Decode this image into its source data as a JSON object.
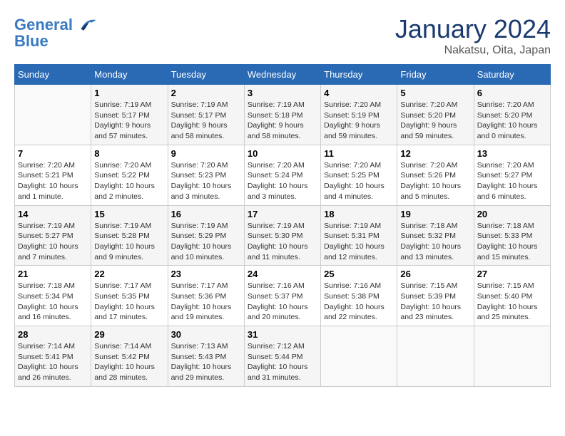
{
  "header": {
    "logo_line1": "General",
    "logo_line2": "Blue",
    "month_title": "January 2024",
    "subtitle": "Nakatsu, Oita, Japan"
  },
  "weekdays": [
    "Sunday",
    "Monday",
    "Tuesday",
    "Wednesday",
    "Thursday",
    "Friday",
    "Saturday"
  ],
  "weeks": [
    [
      {
        "day": "",
        "info": ""
      },
      {
        "day": "1",
        "info": "Sunrise: 7:19 AM\nSunset: 5:17 PM\nDaylight: 9 hours\nand 57 minutes."
      },
      {
        "day": "2",
        "info": "Sunrise: 7:19 AM\nSunset: 5:17 PM\nDaylight: 9 hours\nand 58 minutes."
      },
      {
        "day": "3",
        "info": "Sunrise: 7:19 AM\nSunset: 5:18 PM\nDaylight: 9 hours\nand 58 minutes."
      },
      {
        "day": "4",
        "info": "Sunrise: 7:20 AM\nSunset: 5:19 PM\nDaylight: 9 hours\nand 59 minutes."
      },
      {
        "day": "5",
        "info": "Sunrise: 7:20 AM\nSunset: 5:20 PM\nDaylight: 9 hours\nand 59 minutes."
      },
      {
        "day": "6",
        "info": "Sunrise: 7:20 AM\nSunset: 5:20 PM\nDaylight: 10 hours\nand 0 minutes."
      }
    ],
    [
      {
        "day": "7",
        "info": "Sunrise: 7:20 AM\nSunset: 5:21 PM\nDaylight: 10 hours\nand 1 minute."
      },
      {
        "day": "8",
        "info": "Sunrise: 7:20 AM\nSunset: 5:22 PM\nDaylight: 10 hours\nand 2 minutes."
      },
      {
        "day": "9",
        "info": "Sunrise: 7:20 AM\nSunset: 5:23 PM\nDaylight: 10 hours\nand 3 minutes."
      },
      {
        "day": "10",
        "info": "Sunrise: 7:20 AM\nSunset: 5:24 PM\nDaylight: 10 hours\nand 3 minutes."
      },
      {
        "day": "11",
        "info": "Sunrise: 7:20 AM\nSunset: 5:25 PM\nDaylight: 10 hours\nand 4 minutes."
      },
      {
        "day": "12",
        "info": "Sunrise: 7:20 AM\nSunset: 5:26 PM\nDaylight: 10 hours\nand 5 minutes."
      },
      {
        "day": "13",
        "info": "Sunrise: 7:20 AM\nSunset: 5:27 PM\nDaylight: 10 hours\nand 6 minutes."
      }
    ],
    [
      {
        "day": "14",
        "info": "Sunrise: 7:19 AM\nSunset: 5:27 PM\nDaylight: 10 hours\nand 7 minutes."
      },
      {
        "day": "15",
        "info": "Sunrise: 7:19 AM\nSunset: 5:28 PM\nDaylight: 10 hours\nand 9 minutes."
      },
      {
        "day": "16",
        "info": "Sunrise: 7:19 AM\nSunset: 5:29 PM\nDaylight: 10 hours\nand 10 minutes."
      },
      {
        "day": "17",
        "info": "Sunrise: 7:19 AM\nSunset: 5:30 PM\nDaylight: 10 hours\nand 11 minutes."
      },
      {
        "day": "18",
        "info": "Sunrise: 7:19 AM\nSunset: 5:31 PM\nDaylight: 10 hours\nand 12 minutes."
      },
      {
        "day": "19",
        "info": "Sunrise: 7:18 AM\nSunset: 5:32 PM\nDaylight: 10 hours\nand 13 minutes."
      },
      {
        "day": "20",
        "info": "Sunrise: 7:18 AM\nSunset: 5:33 PM\nDaylight: 10 hours\nand 15 minutes."
      }
    ],
    [
      {
        "day": "21",
        "info": "Sunrise: 7:18 AM\nSunset: 5:34 PM\nDaylight: 10 hours\nand 16 minutes."
      },
      {
        "day": "22",
        "info": "Sunrise: 7:17 AM\nSunset: 5:35 PM\nDaylight: 10 hours\nand 17 minutes."
      },
      {
        "day": "23",
        "info": "Sunrise: 7:17 AM\nSunset: 5:36 PM\nDaylight: 10 hours\nand 19 minutes."
      },
      {
        "day": "24",
        "info": "Sunrise: 7:16 AM\nSunset: 5:37 PM\nDaylight: 10 hours\nand 20 minutes."
      },
      {
        "day": "25",
        "info": "Sunrise: 7:16 AM\nSunset: 5:38 PM\nDaylight: 10 hours\nand 22 minutes."
      },
      {
        "day": "26",
        "info": "Sunrise: 7:15 AM\nSunset: 5:39 PM\nDaylight: 10 hours\nand 23 minutes."
      },
      {
        "day": "27",
        "info": "Sunrise: 7:15 AM\nSunset: 5:40 PM\nDaylight: 10 hours\nand 25 minutes."
      }
    ],
    [
      {
        "day": "28",
        "info": "Sunrise: 7:14 AM\nSunset: 5:41 PM\nDaylight: 10 hours\nand 26 minutes."
      },
      {
        "day": "29",
        "info": "Sunrise: 7:14 AM\nSunset: 5:42 PM\nDaylight: 10 hours\nand 28 minutes."
      },
      {
        "day": "30",
        "info": "Sunrise: 7:13 AM\nSunset: 5:43 PM\nDaylight: 10 hours\nand 29 minutes."
      },
      {
        "day": "31",
        "info": "Sunrise: 7:12 AM\nSunset: 5:44 PM\nDaylight: 10 hours\nand 31 minutes."
      },
      {
        "day": "",
        "info": ""
      },
      {
        "day": "",
        "info": ""
      },
      {
        "day": "",
        "info": ""
      }
    ]
  ]
}
